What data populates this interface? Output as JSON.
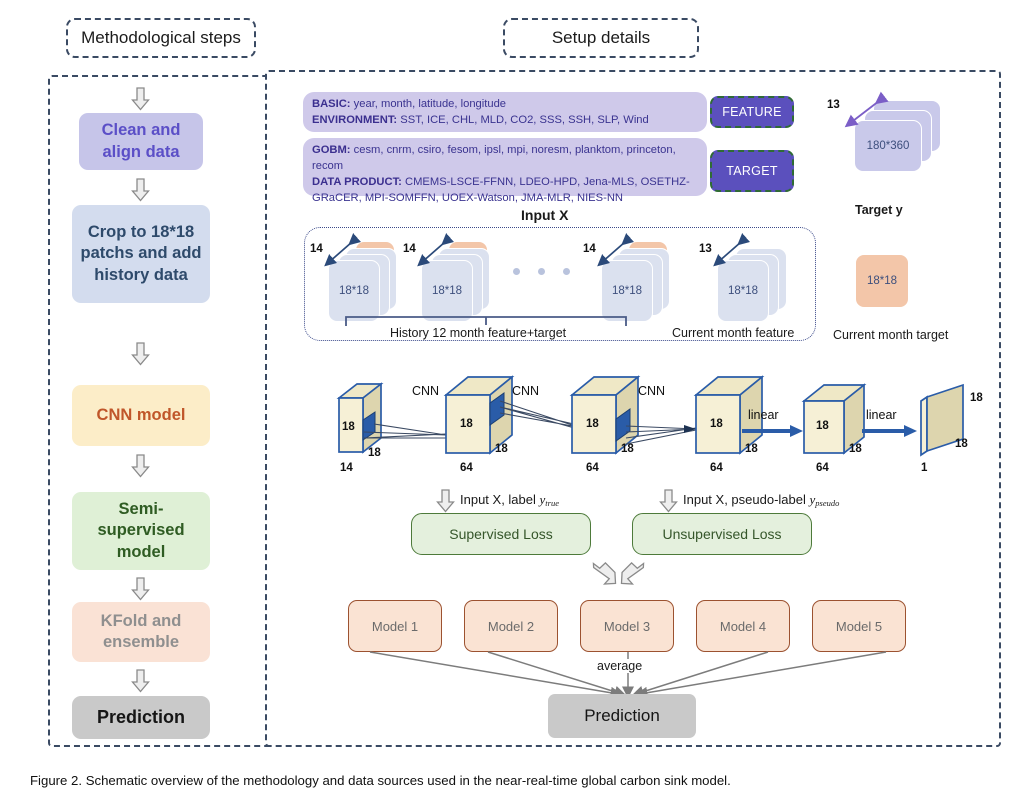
{
  "figure": {
    "caption": "Figure 2. Schematic overview of the methodology and data sources used in the near-real-time global carbon sink model."
  },
  "left_panel": {
    "header": "Methodological steps",
    "steps": [
      {
        "label": "Clean and align data",
        "color": "#c6c5e9",
        "text_color": "#5b4fc7"
      },
      {
        "label": "Crop to 18*18 patchs and add history data",
        "color": "#d3dcee",
        "text_color": "#2e4a6b"
      },
      {
        "label": "CNN model",
        "color": "#fcedc8",
        "text_color": "#c0562a"
      },
      {
        "label": "Semi-supervised model",
        "color": "#dff0d6",
        "text_color": "#2f5c23"
      },
      {
        "label": "KFold and ensemble",
        "color": "#fae2d5",
        "text_color": "#8f8f8f"
      },
      {
        "label": "Prediction",
        "color": "#c9c9c9",
        "text_color": "#151515"
      }
    ]
  },
  "right_panel": {
    "header": "Setup details",
    "feature_block": {
      "rows": [
        {
          "key": "BASIC:",
          "value": "year, month, latitude, longitude"
        },
        {
          "key": "ENVIRONMENT:",
          "value": "SST, ICE, CHL, MLD, CO2, SSS, SSH, SLP, Wind"
        }
      ],
      "tag": "FEATURE"
    },
    "target_block": {
      "rows": [
        {
          "key": "GOBM:",
          "value": "cesm, cnrm, csiro, fesom, ipsl, mpi, noresm, planktom, princeton, recom"
        },
        {
          "key": "DATA PRODUCT:",
          "value": "CMEMS-LSCE-FFNN, LDEO-HPD, Jena-MLS, OSETHZ-GRaCER, MPI-SOMFFN, UOEX-Watson, JMA-MLR, NIES-NN"
        }
      ],
      "tag": "TARGET"
    },
    "target_y": {
      "title": "Target y",
      "depth": "13",
      "grid": "180*360"
    },
    "input_x": {
      "title": "Input X",
      "history_label": "History 12 month feature+target",
      "current_label": "Current month feature",
      "history_stacks": [
        {
          "depth": "14",
          "size": "18*18"
        },
        {
          "depth": "14",
          "size": "18*18"
        },
        {
          "depth": "14",
          "size": "18*18"
        }
      ],
      "current_stack": {
        "depth": "13",
        "size": "18*18"
      }
    },
    "current_month_target": {
      "size": "18*18",
      "label": "Current month target"
    },
    "cnn": {
      "ops": [
        "CNN",
        "CNN",
        "CNN",
        "linear",
        "linear"
      ],
      "layers": [
        {
          "face": "18",
          "depth": "18",
          "channels": "14"
        },
        {
          "face": "18",
          "depth": "18",
          "channels": "64"
        },
        {
          "face": "18",
          "depth": "18",
          "channels": "64"
        },
        {
          "face": "18",
          "depth": "18",
          "channels": "64"
        },
        {
          "face": "18",
          "depth": "18",
          "channels": "64"
        },
        {
          "face": "18",
          "depth": "18",
          "channels": "1"
        }
      ]
    },
    "losses": [
      {
        "arrow_label_pre": "Input X, label ",
        "arrow_label_var": "y",
        "arrow_label_sub": "true",
        "box": "Supervised Loss"
      },
      {
        "arrow_label_pre": "Input X, pseudo-label ",
        "arrow_label_var": "y",
        "arrow_label_sub": "pseudo",
        "box": "Unsupervised Loss"
      }
    ],
    "ensemble": {
      "models": [
        "Model 1",
        "Model 2",
        "Model 3",
        "Model 4",
        "Model 5"
      ],
      "average_label": "average",
      "prediction_label": "Prediction"
    }
  }
}
